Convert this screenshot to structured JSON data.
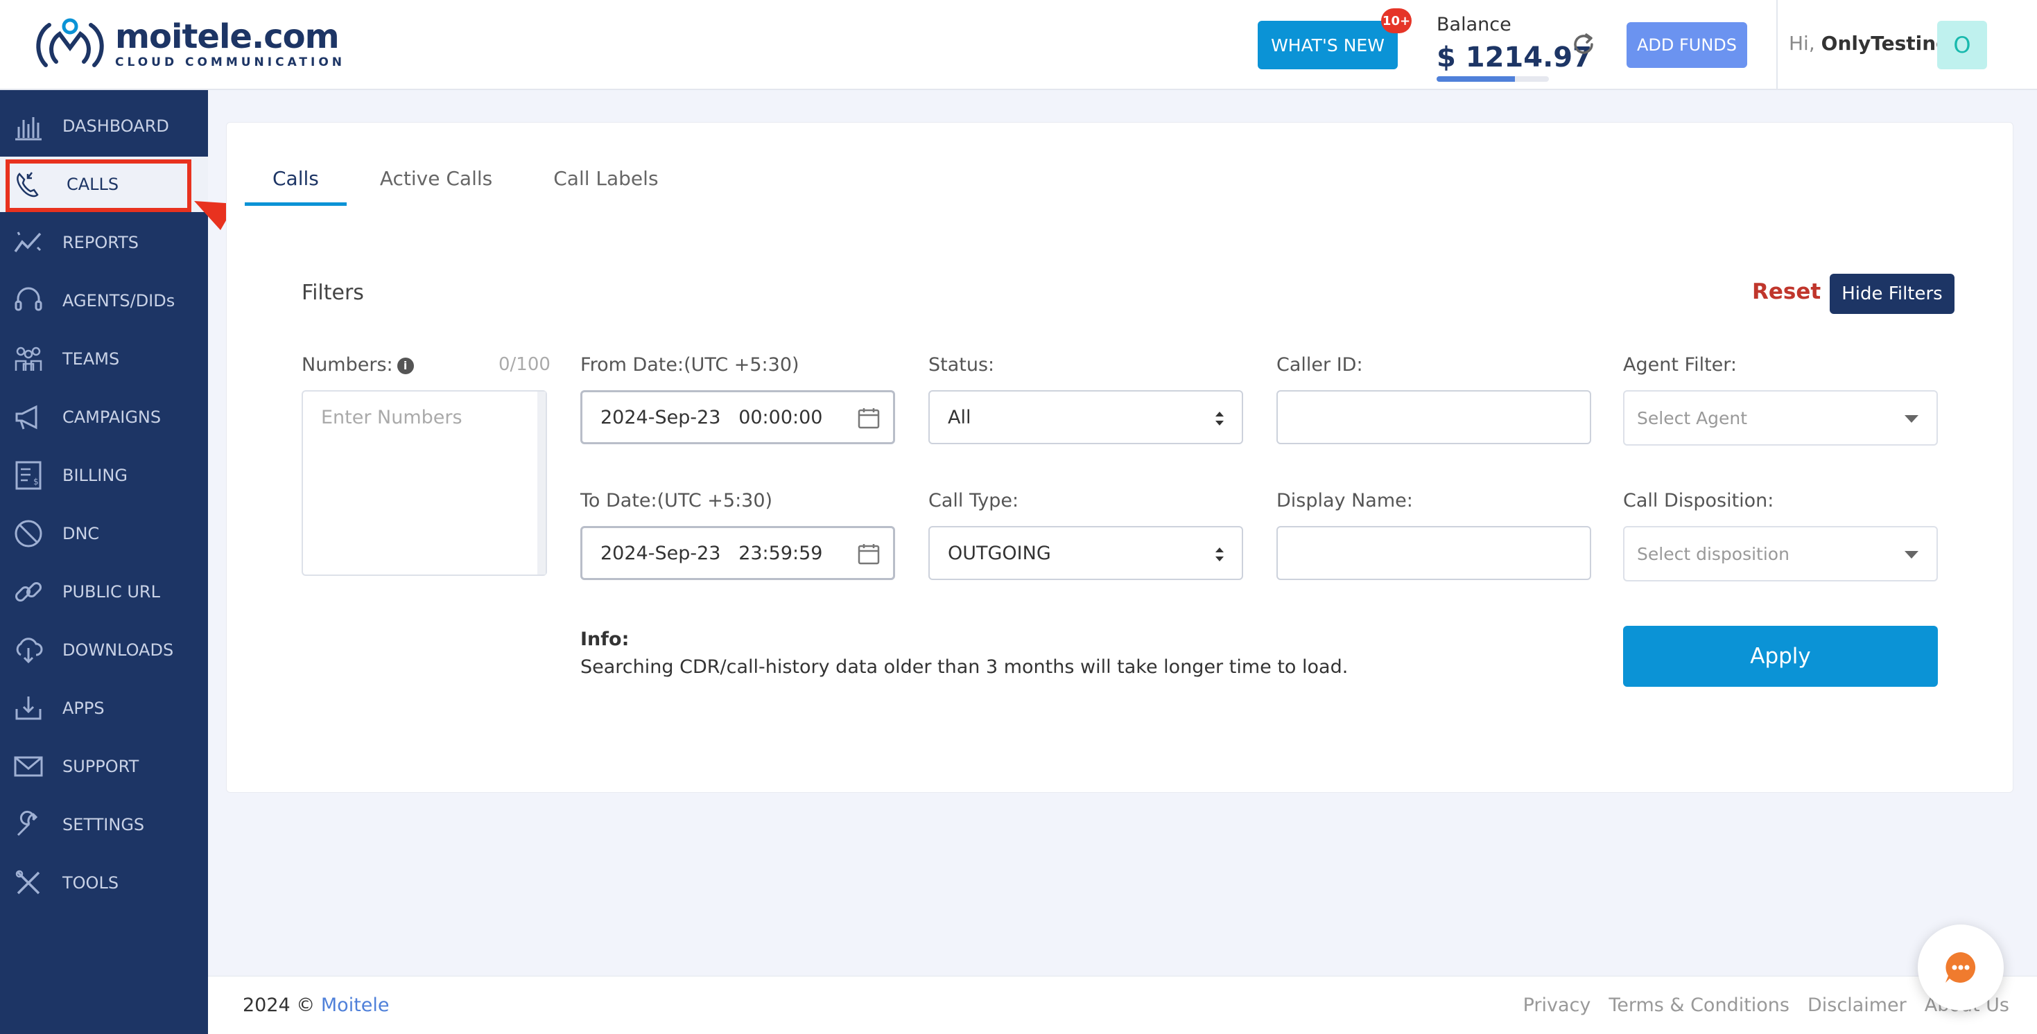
{
  "header": {
    "logo_name": "moitele.com",
    "logo_sub": "CLOUD COMMUNICATION",
    "whats_new_label": "WHAT'S NEW",
    "whats_new_badge": "10+",
    "balance_label": "Balance",
    "balance_value": "$ 1214.97",
    "balance_progress_percent": 70,
    "add_funds_label": "ADD FUNDS",
    "greeting_prefix": "Hi,",
    "user_name": "OnlyTesting",
    "avatar_initial": "O"
  },
  "sidebar": {
    "items": [
      {
        "label": "DASHBOARD",
        "icon": "dashboard-icon"
      },
      {
        "label": "CALLS",
        "icon": "calls-icon",
        "active": true
      },
      {
        "label": "REPORTS",
        "icon": "reports-icon"
      },
      {
        "label": "AGENTS/DIDs",
        "icon": "headset-icon"
      },
      {
        "label": "TEAMS",
        "icon": "teams-icon"
      },
      {
        "label": "CAMPAIGNS",
        "icon": "megaphone-icon"
      },
      {
        "label": "BILLING",
        "icon": "billing-icon"
      },
      {
        "label": "DNC",
        "icon": "dnc-icon"
      },
      {
        "label": "PUBLIC URL",
        "icon": "link-icon"
      },
      {
        "label": "DOWNLOADS",
        "icon": "cloud-download-icon"
      },
      {
        "label": "APPS",
        "icon": "apps-download-icon"
      },
      {
        "label": "SUPPORT",
        "icon": "mail-icon"
      },
      {
        "label": "SETTINGS",
        "icon": "wrench-icon"
      },
      {
        "label": "TOOLS",
        "icon": "tools-icon"
      }
    ]
  },
  "tabs": [
    {
      "label": "Calls",
      "active": true
    },
    {
      "label": "Active Calls"
    },
    {
      "label": "Call Labels"
    }
  ],
  "filters": {
    "title": "Filters",
    "reset_label": "Reset",
    "hide_label": "Hide Filters",
    "numbers_label": "Numbers:",
    "numbers_count": "0/100",
    "numbers_placeholder": "Enter Numbers",
    "from_date_label": "From Date:(UTC +5:30)",
    "from_date_value": "2024-Sep-23   00:00:00",
    "to_date_label": "To Date:(UTC +5:30)",
    "to_date_value": "2024-Sep-23   23:59:59",
    "status_label": "Status:",
    "status_value": "All",
    "call_type_label": "Call Type:",
    "call_type_value": "OUTGOING",
    "caller_id_label": "Caller ID:",
    "caller_id_value": "",
    "display_name_label": "Display Name:",
    "display_name_value": "",
    "agent_filter_label": "Agent Filter:",
    "agent_filter_placeholder": "Select Agent",
    "disposition_label": "Call Disposition:",
    "disposition_placeholder": "Select disposition",
    "info_title": "Info:",
    "info_text": "Searching CDR/call-history data older than 3 months will take longer time to load.",
    "apply_label": "Apply"
  },
  "footer": {
    "copyright": "2024 ©",
    "company_link": "Moitele",
    "links": [
      "Privacy",
      "Terms & Conditions",
      "Disclaimer",
      "About Us"
    ]
  },
  "colors": {
    "sidebar_bg": "#1d3565",
    "accent": "#0b93d6",
    "reset": "#c0362c",
    "annotation_red": "#e8321f"
  }
}
